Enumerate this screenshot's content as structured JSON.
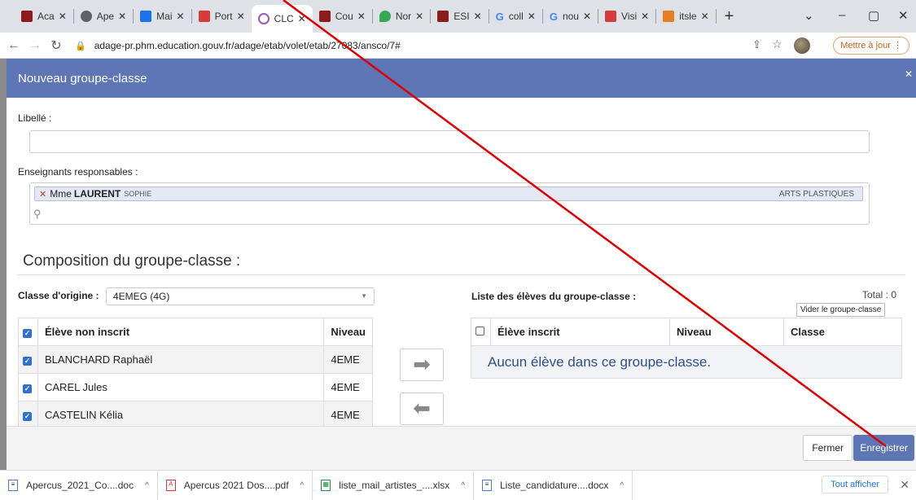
{
  "browser": {
    "tabs": [
      {
        "label": "Aca",
        "color": "#8b1c1c"
      },
      {
        "label": "Ape",
        "color": "#5f6368"
      },
      {
        "label": "Mai",
        "color": "#1a73e8"
      },
      {
        "label": "Port",
        "color": "#d83b3b"
      },
      {
        "label": "CLC",
        "color": "#9b59b6",
        "active": true
      },
      {
        "label": "Cou",
        "color": "#8b1c1c"
      },
      {
        "label": "Nor",
        "color": "#34a853"
      },
      {
        "label": "ESI",
        "color": "#8b1c1c"
      },
      {
        "label": "coll",
        "color": "#4285f4"
      },
      {
        "label": "nou",
        "color": "#4285f4"
      },
      {
        "label": "Visi",
        "color": "#d83b3b"
      },
      {
        "label": "itsle",
        "color": "#e67e22"
      }
    ],
    "url": "adage-pr.phm.education.gouv.fr/adage/etab/volet/etab/27083/ansco/7#",
    "update_label": "Mettre à jour"
  },
  "modal": {
    "title": "Nouveau groupe-classe",
    "libelle_label": "Libellé :",
    "libelle_value": "",
    "enseignants_label": "Enseignants responsables :",
    "teacher": {
      "civilite": "Mme",
      "nom": "LAURENT",
      "prenom": "SOPHIE",
      "discipline": "ARTS PLASTIQUES"
    },
    "composition_title": "Composition du groupe-classe :",
    "classe_origine_label": "Classe d'origine :",
    "classe_origine_value": "4EMEG (4G)",
    "left_table": {
      "headers": {
        "eleve": "Élève non inscrit",
        "niveau": "Niveau"
      },
      "rows": [
        {
          "name": "BLANCHARD Raphaël",
          "niveau": "4EME",
          "checked": true
        },
        {
          "name": "CAREL Jules",
          "niveau": "4EME",
          "checked": true
        },
        {
          "name": "CASTELIN Kélia",
          "niveau": "4EME",
          "checked": true
        }
      ]
    },
    "right": {
      "title": "Liste des élèves du groupe-classe :",
      "total": "Total : 0",
      "vider_label": "Vider le groupe-classe",
      "headers": {
        "eleve": "Élève inscrit",
        "niveau": "Niveau",
        "classe": "Classe"
      },
      "empty_message": "Aucun élève dans ce groupe-classe."
    },
    "buttons": {
      "fermer": "Fermer",
      "enregistrer": "Enregistrer"
    }
  },
  "downloads": {
    "items": [
      {
        "name": "Apercus_2021_Co....doc",
        "icon": "doc-icon"
      },
      {
        "name": "Apercus 2021 Dos....pdf",
        "icon": "pdf-icon"
      },
      {
        "name": "liste_mail_artistes_....xlsx",
        "icon": "xlsx-icon"
      },
      {
        "name": "Liste_candidature....docx",
        "icon": "docx-icon"
      }
    ],
    "show_all": "Tout afficher"
  },
  "colors": {
    "header": "#5e75b6",
    "primary_button": "#5e75b6",
    "annotation_line": "#e00000"
  }
}
